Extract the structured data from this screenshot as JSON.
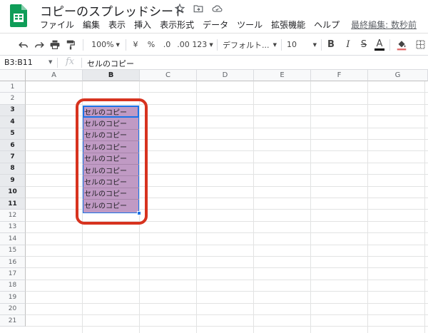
{
  "app": {
    "document_title": "コピーのスプレッドシート",
    "logo_color": "#0f9d58",
    "accent_color": "#1a73e8",
    "highlight_color": "#d7331f",
    "selection_fill": "#c09ac4"
  },
  "title_icons": [
    "star-icon",
    "move-to-folder-icon",
    "cloud-status-icon"
  ],
  "menu": {
    "items": [
      "ファイル",
      "編集",
      "表示",
      "挿入",
      "表示形式",
      "データ",
      "ツール",
      "拡張機能",
      "ヘルプ"
    ],
    "last_edit": "最終編集: 数秒前"
  },
  "toolbar": {
    "zoom": "100%",
    "currency": "¥",
    "percent": "%",
    "decrease_decimal": ".0",
    "increase_decimal": ".00",
    "more_formats": "123",
    "font": "デフォルト...",
    "font_size": "10",
    "bold": "B",
    "italic": "I",
    "strikethrough": "S",
    "text_color": "A"
  },
  "formula_bar": {
    "name_box": "B3:B11",
    "fx": "fx",
    "content": "セルのコピー"
  },
  "grid": {
    "columns": [
      "A",
      "B",
      "C",
      "D",
      "E",
      "F",
      "G"
    ],
    "selected_column": "B",
    "rows": [
      "1",
      "2",
      "3",
      "4",
      "5",
      "6",
      "7",
      "8",
      "9",
      "10",
      "11",
      "12",
      "13",
      "14",
      "15",
      "16",
      "17",
      "18",
      "19",
      "20",
      "21"
    ],
    "selected_rows": [
      "3",
      "4",
      "5",
      "6",
      "7",
      "8",
      "9",
      "10",
      "11"
    ],
    "cells_B3_B11": [
      "セルのコピー",
      "セルのコピー",
      "セルのコピー",
      "セルのコピー",
      "セルのコピー",
      "セルのコピー",
      "セルのコピー",
      "セルのコピー",
      "セルのコピー"
    ]
  }
}
